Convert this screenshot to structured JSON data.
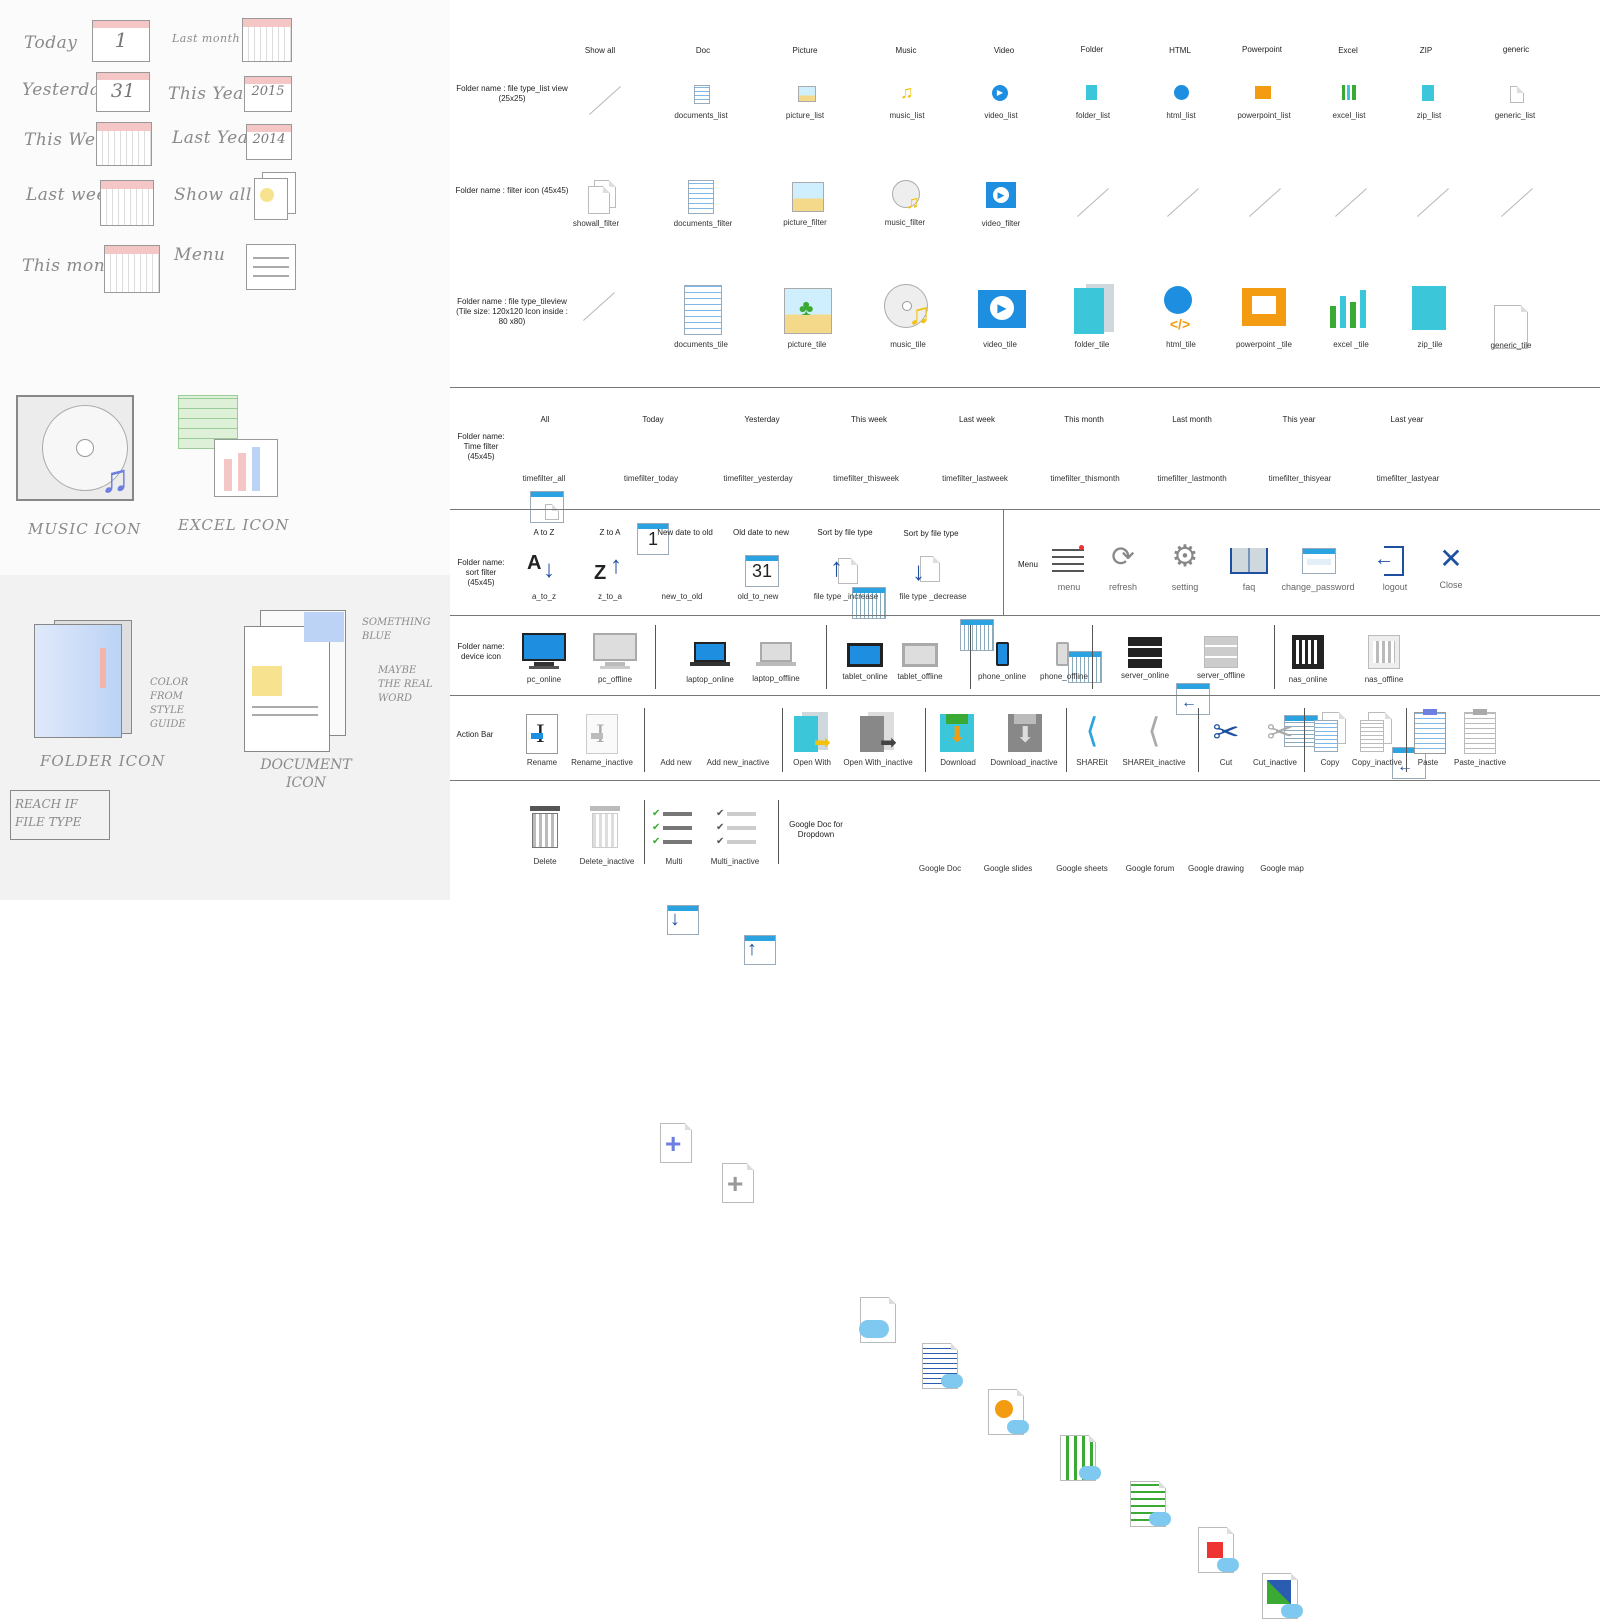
{
  "sketch": {
    "time_labels": [
      "Today",
      "Yesterday",
      "This Week",
      "Last week",
      "This month"
    ],
    "time_labels_right": [
      "Last month",
      "This Year",
      "Last Year",
      "Show all",
      "Menu"
    ],
    "calendar_numbers": [
      "1",
      "31",
      "2015",
      "2014"
    ],
    "music_label": "MUSIC ICON",
    "excel_label": "EXCEL ICON",
    "folder_label": "FOLDER ICON",
    "document_label": "DOCUMENT ICON",
    "note_color": "COLOR FROM STYLE GUIDE",
    "note_blue": "SOMETHING BLUE",
    "note_word": "MAYBE THE REAL WORD",
    "note_reach": "REACH IF FILE TYPE"
  },
  "file_types": {
    "headers": [
      "Show all",
      "Doc",
      "Picture",
      "Music",
      "Video",
      "Folder",
      "HTML",
      "Powerpoint",
      "Excel",
      "ZIP",
      "generic"
    ],
    "list_row_label": "Folder name : file type_list view (25x25)",
    "list_captions": [
      "documents_list",
      "picture_list",
      "music_list",
      "video_list",
      "folder_list",
      "html_list",
      "powerpoint_list",
      "excel_list",
      "zip_list",
      "generic_list"
    ],
    "filter_row_label": "Folder name : filter icon (45x45)",
    "filter_captions": [
      "showall_filter",
      "documents_filter",
      "picture_filter",
      "music_filter",
      "video_filter"
    ],
    "tile_row_label": "Folder name : file type_tileview (Tile size: 120x120 Icon inside : 80 x80)",
    "tile_captions": [
      "documents_tile",
      "picture_tile",
      "music_tile",
      "video_tile",
      "folder_tile",
      "html_tile",
      "powerpoint _tile",
      "excel _tile",
      "zip_tile",
      "generic_tile"
    ]
  },
  "time_filter": {
    "row_label": "Folder name: Time filter (45x45)",
    "headers": [
      "All",
      "Today",
      "Yesterday",
      "This week",
      "Last week",
      "This month",
      "Last month",
      "This year",
      "Last year"
    ],
    "numbers": {
      "today": "1",
      "yesterday": "31"
    },
    "captions": [
      "timefilter_all",
      "timefilter_today",
      "timefilter_yesterday",
      "timefilter_thisweek",
      "timefilter_lastweek",
      "timefilter_thismonth",
      "timefilter_lastmonth",
      "timefilter_thisyear",
      "timefilter_lastyear"
    ]
  },
  "sort_filter": {
    "row_label": "Folder name: sort filter (45x45)",
    "headers": [
      "A to Z",
      "Z to A",
      "New date to old",
      "Old date to new",
      "Sort by file type",
      "Sort by file type"
    ],
    "letters": {
      "a": "A",
      "z": "Z"
    },
    "captions": [
      "a_to_z",
      "z_to_a",
      "new_to_old",
      "old_to_new",
      "file type _increase",
      "file type _decrease"
    ]
  },
  "menu": {
    "row_label": "Menu",
    "captions": [
      "menu",
      "refresh",
      "setting",
      "faq",
      "change_password",
      "logout",
      "Close"
    ]
  },
  "devices": {
    "row_label": "Folder name: device icon",
    "captions": [
      "pc_online",
      "pc_offline",
      "laptop_online",
      "laptop_offline",
      "tablet_online",
      "tablet_offline",
      "phone_online",
      "phone_offline",
      "server_online",
      "server_offline",
      "nas_online",
      "nas_offline"
    ]
  },
  "action_bar": {
    "row_label": "Action Bar",
    "captions": [
      "Rename",
      "Rename_inactive",
      "Add new",
      "Add new_inactive",
      "Open With",
      "Open With_inactive",
      "Download",
      "Download_inactive",
      "SHAREit",
      "SHAREit_inactive",
      "Cut",
      "Cut_inactive",
      "Copy",
      "Copy_inactive",
      "Paste",
      "Paste_inactive"
    ],
    "rename_glyph": "I"
  },
  "bottom": {
    "captions": [
      "Delete",
      "Delete_inactive",
      "Multi",
      "Multi_inactive"
    ],
    "google_label": "Google Doc for Dropdown",
    "google_captions": [
      "Google Doc",
      "Google slides",
      "Google sheets",
      "Google forum",
      "Google drawing",
      "Google map"
    ]
  },
  "colors": {
    "accent_blue": "#2aa3e0",
    "sketch_red": "#f4c6c6",
    "tile_cyan": "#3cc6d9",
    "orange": "#f39c12",
    "green": "#3aaa35"
  }
}
